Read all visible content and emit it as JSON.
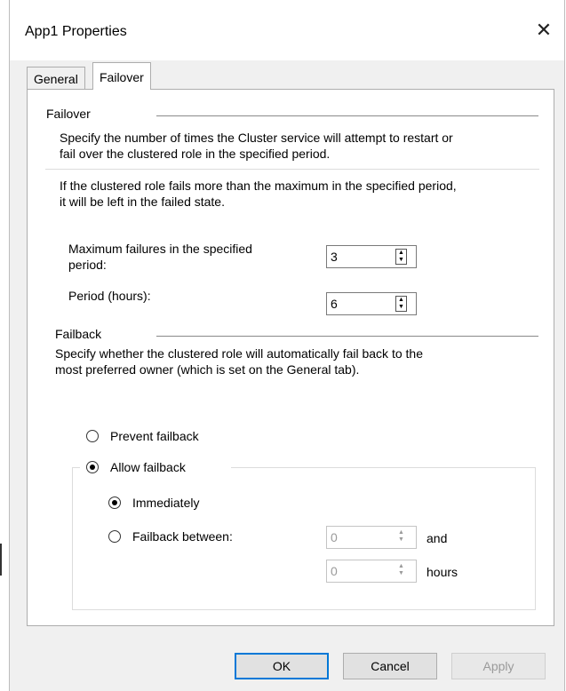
{
  "window": {
    "title": "App1 Properties",
    "close_glyph": "✕"
  },
  "tabs": [
    {
      "label": "General"
    },
    {
      "label": "Failover"
    }
  ],
  "failover": {
    "heading": "Failover",
    "desc1_line1": "Specify the number of times the Cluster service will attempt to restart or",
    "desc1_line2": "fail over the clustered role in the specified period.",
    "desc2_line1": "If the clustered role fails more than the maximum in the specified period,",
    "desc2_line2": "it will be left in the failed state.",
    "max_failures_label_line1": "Maximum failures in the specified",
    "max_failures_label_line2": "period:",
    "max_failures_value": "3",
    "period_label": "Period (hours):",
    "period_value": "6"
  },
  "failback": {
    "heading": "Failback",
    "desc_line1": "Specify whether the clustered role will automatically fail back to the",
    "desc_line2": "most preferred owner (which is set on the General tab).",
    "prevent_label": "Prevent failback",
    "allow_label": "Allow failback",
    "allow_selected": true,
    "immediately_label": "Immediately",
    "immediately_selected": true,
    "between_label": "Failback between:",
    "between_start_value": "0",
    "and_label": "and",
    "between_end_value": "0",
    "hours_label": "hours"
  },
  "buttons": {
    "ok": "OK",
    "cancel": "Cancel",
    "apply": "Apply"
  },
  "colors": {
    "accent": "#0078d7",
    "dialog_bg": "#f0f0f0",
    "panel_bg": "#ffffff"
  },
  "icons": {
    "spinner": "spinner-arrows-icon",
    "close": "close-icon"
  }
}
